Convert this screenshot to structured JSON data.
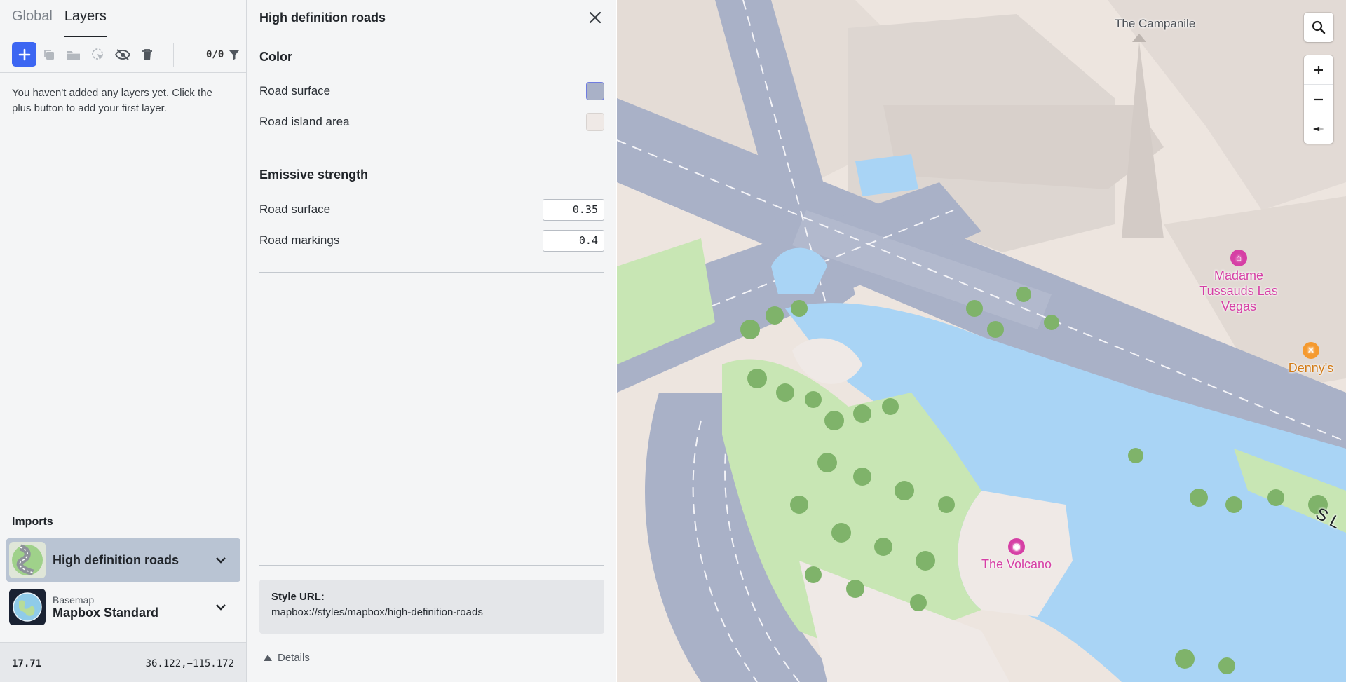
{
  "sidebar": {
    "tabs": [
      {
        "label": "Global",
        "active": false
      },
      {
        "label": "Layers",
        "active": true
      }
    ],
    "toolbar": {
      "layer_count": "0/0",
      "icons": [
        "plus-icon",
        "duplicate-icon",
        "folder-icon",
        "select-icon",
        "hide-icon",
        "trash-icon",
        "filter-icon"
      ]
    },
    "empty_message": "You haven't added any layers yet. Click the plus button to add your first layer.",
    "imports": {
      "title": "Imports",
      "items": [
        {
          "subtitle": "",
          "name": "High definition roads",
          "selected": true
        },
        {
          "subtitle": "Basemap",
          "name": "Mapbox Standard",
          "selected": false
        }
      ]
    },
    "status": {
      "zoom": "17.71",
      "coordinates": "36.122,−115.172"
    }
  },
  "panel": {
    "title": "High definition roads",
    "color_section": {
      "title": "Color",
      "rows": [
        {
          "label": "Road surface",
          "color": "#a9b1c7"
        },
        {
          "label": "Road island area",
          "color": "#efe9e6"
        }
      ]
    },
    "emissive_section": {
      "title": "Emissive strength",
      "rows": [
        {
          "label": "Road surface",
          "value": "0.35"
        },
        {
          "label": "Road markings",
          "value": "0.4"
        }
      ]
    },
    "style_url": {
      "label": "Style URL:",
      "value": "mapbox://styles/mapbox/high-definition-roads"
    },
    "details_label": "Details"
  },
  "map": {
    "labels": {
      "campanile": "The Campanile",
      "madame_tussauds": "Madame Tussauds Las Vegas",
      "dennys": "Denny's",
      "volcano": "The Volcano",
      "street_fragment": "S L"
    },
    "controls": [
      "search-icon",
      "zoom-in-icon",
      "zoom-out-icon",
      "compass-icon"
    ],
    "colors": {
      "water": "#a9d4f5",
      "park": "#c8e6b4",
      "road": "#a9b1c7",
      "ground": "#efe9e6",
      "poi": "#d63fa5",
      "food": "#f59a2f"
    }
  }
}
